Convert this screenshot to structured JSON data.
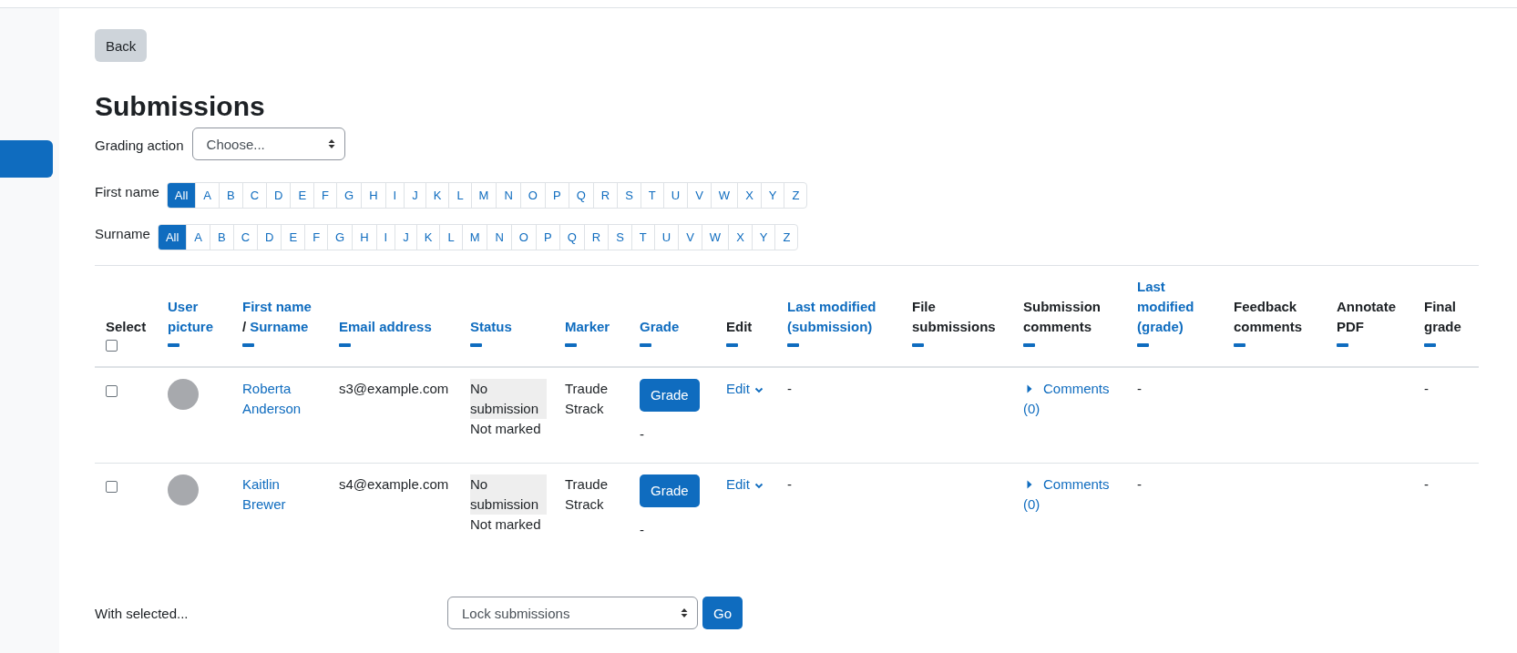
{
  "back_button": "Back",
  "heading": "Submissions",
  "grading_action": {
    "label": "Grading action",
    "value": "Choose..."
  },
  "initial_bars": [
    {
      "label": "First name",
      "letters": [
        {
          "text": "All",
          "selected": true
        },
        {
          "text": "A",
          "selected": false
        },
        {
          "text": "B",
          "selected": false
        },
        {
          "text": "C",
          "selected": false
        },
        {
          "text": "D",
          "selected": false
        },
        {
          "text": "E",
          "selected": false
        },
        {
          "text": "F",
          "selected": false
        },
        {
          "text": "G",
          "selected": false
        },
        {
          "text": "H",
          "selected": false
        },
        {
          "text": "I",
          "selected": false
        },
        {
          "text": "J",
          "selected": false
        },
        {
          "text": "K",
          "selected": false
        },
        {
          "text": "L",
          "selected": false
        },
        {
          "text": "M",
          "selected": false
        },
        {
          "text": "N",
          "selected": false
        },
        {
          "text": "O",
          "selected": false
        },
        {
          "text": "P",
          "selected": false
        },
        {
          "text": "Q",
          "selected": false
        },
        {
          "text": "R",
          "selected": false
        },
        {
          "text": "S",
          "selected": false
        },
        {
          "text": "T",
          "selected": false
        },
        {
          "text": "U",
          "selected": false
        },
        {
          "text": "V",
          "selected": false
        },
        {
          "text": "W",
          "selected": false
        },
        {
          "text": "X",
          "selected": false
        },
        {
          "text": "Y",
          "selected": false
        },
        {
          "text": "Z",
          "selected": false
        }
      ]
    },
    {
      "label": "Surname",
      "letters": [
        {
          "text": "All",
          "selected": true
        },
        {
          "text": "A",
          "selected": false
        },
        {
          "text": "B",
          "selected": false
        },
        {
          "text": "C",
          "selected": false
        },
        {
          "text": "D",
          "selected": false
        },
        {
          "text": "E",
          "selected": false
        },
        {
          "text": "F",
          "selected": false
        },
        {
          "text": "G",
          "selected": false
        },
        {
          "text": "H",
          "selected": false
        },
        {
          "text": "I",
          "selected": false
        },
        {
          "text": "J",
          "selected": false
        },
        {
          "text": "K",
          "selected": false
        },
        {
          "text": "L",
          "selected": false
        },
        {
          "text": "M",
          "selected": false
        },
        {
          "text": "N",
          "selected": false
        },
        {
          "text": "O",
          "selected": false
        },
        {
          "text": "P",
          "selected": false
        },
        {
          "text": "Q",
          "selected": false
        },
        {
          "text": "R",
          "selected": false
        },
        {
          "text": "S",
          "selected": false
        },
        {
          "text": "T",
          "selected": false
        },
        {
          "text": "U",
          "selected": false
        },
        {
          "text": "V",
          "selected": false
        },
        {
          "text": "W",
          "selected": false
        },
        {
          "text": "X",
          "selected": false
        },
        {
          "text": "Y",
          "selected": false
        },
        {
          "text": "Z",
          "selected": false
        }
      ]
    }
  ],
  "table": {
    "columns": [
      {
        "kind": "checkbox",
        "label": "Select",
        "checked": false
      },
      {
        "kind": "sortable",
        "label": "User picture"
      },
      {
        "kind": "double",
        "label": "First name",
        "separator": "/",
        "second_label": "Surname"
      },
      {
        "kind": "sortable",
        "label": "Email address"
      },
      {
        "kind": "sortable",
        "label": "Status"
      },
      {
        "kind": "sortable",
        "label": "Marker"
      },
      {
        "kind": "sortable",
        "label": "Grade"
      },
      {
        "kind": "plain",
        "label": "Edit"
      },
      {
        "kind": "sortable",
        "label": "Last modified (submission)"
      },
      {
        "kind": "plain",
        "label": "File submissions"
      },
      {
        "kind": "plain",
        "label": "Submission comments"
      },
      {
        "kind": "sortable",
        "label": "Last modified (grade)"
      },
      {
        "kind": "plain",
        "label": "Feedback comments"
      },
      {
        "kind": "plain",
        "label": "Annotate PDF"
      },
      {
        "kind": "plain",
        "label": "Final grade"
      }
    ],
    "rows": [
      {
        "checked": false,
        "name": "Roberta Anderson",
        "email": "s3@example.com",
        "status": "No submission",
        "grading_status": "Not marked",
        "marker": "Traude Strack",
        "grade_button": "Grade",
        "grade": "-",
        "edit": "Edit",
        "last_modified_submission": "-",
        "comments": "Comments (0)",
        "last_modified_grade": "-",
        "final_grade": "-"
      },
      {
        "checked": false,
        "name": "Kaitlin Brewer",
        "email": "s4@example.com",
        "status": "No submission",
        "grading_status": "Not marked",
        "marker": "Traude Strack",
        "grade_button": "Grade",
        "grade": "-",
        "edit": "Edit",
        "last_modified_submission": "-",
        "comments": "Comments (0)",
        "last_modified_grade": "-",
        "final_grade": "-"
      }
    ]
  },
  "bulk": {
    "label": "With selected...",
    "value": "Lock submissions",
    "button": "Go"
  }
}
